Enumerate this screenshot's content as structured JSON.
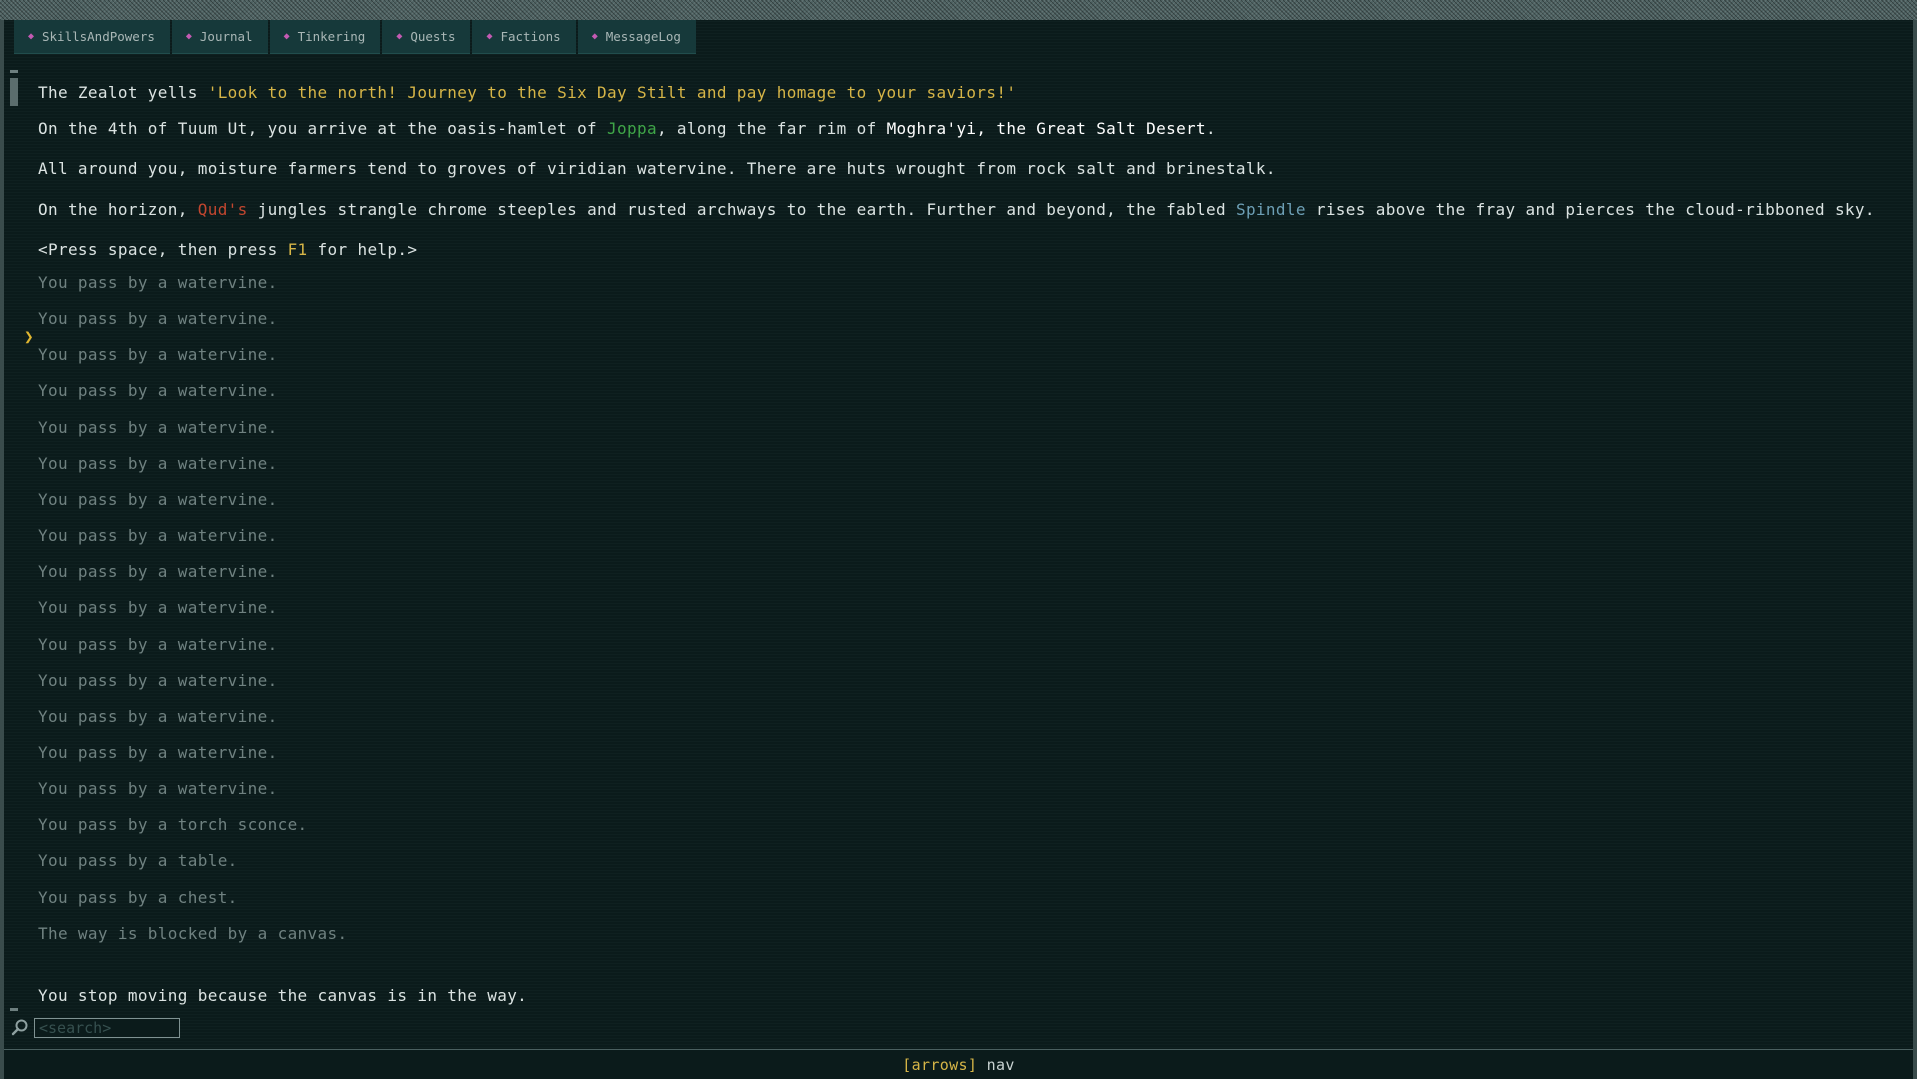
{
  "tabs": [
    {
      "label": "SkillsAndPowers"
    },
    {
      "label": "Journal"
    },
    {
      "label": "Tinkering"
    },
    {
      "label": "Quests"
    },
    {
      "label": "Factions"
    },
    {
      "label": "MessageLog"
    }
  ],
  "log": {
    "intro": {
      "zealot_prefix": "The Zealot yells ",
      "zealot_quote": "'Look to the north! Journey to the Six Day Stilt and pay homage to your saviors!'",
      "arrive_1": "On the 4th of Tuum Ut, you arrive at the oasis-hamlet of ",
      "arrive_joppa": "Joppa",
      "arrive_2": ", along the far rim of ",
      "arrive_moghra": "Moghra'yi, the Great Salt Desert",
      "arrive_3": ".",
      "around": "All around you, moisture farmers tend to groves of viridian watervine. There are huts wrought from rock salt and brinestalk.",
      "horizon_1": "On the horizon, ",
      "horizon_quds": "Qud's",
      "horizon_2": " jungles strangle chrome steeples and rusted archways to the earth. Further and beyond, the fabled ",
      "horizon_spindle": "Spindle",
      "horizon_3": " rises above the fray and pierces the cloud-ribboned sky.",
      "help_1": "<Press space, then press ",
      "help_key": "F1",
      "help_2": " for help.>"
    },
    "messages": [
      "You pass by a watervine.",
      "You pass by a watervine.",
      "You pass by a watervine.",
      "You pass by a watervine.",
      "You pass by a watervine.",
      "You pass by a watervine.",
      "You pass by a watervine.",
      "You pass by a watervine.",
      "You pass by a watervine.",
      "You pass by a watervine.",
      "You pass by a watervine.",
      "You pass by a watervine.",
      "You pass by a watervine.",
      "You pass by a watervine.",
      "You pass by a watervine.",
      "You pass by a torch sconce.",
      "You pass by a table.",
      "You pass by a chest.",
      "The way is blocked by a canvas."
    ],
    "last_message": "You stop moving because the canvas is in the way."
  },
  "search": {
    "placeholder": "<search>"
  },
  "status": {
    "key": "[arrows]",
    "action": "nav"
  },
  "icons": {
    "tab": "gem-icon",
    "selection": "chevron-right-icon",
    "search": "magnifier-icon"
  },
  "colors": {
    "highlight_yellow": "#d6b547",
    "place_green": "#3fa648",
    "qud_red": "#c2462f",
    "spindle_blue": "#6d9fb5"
  }
}
